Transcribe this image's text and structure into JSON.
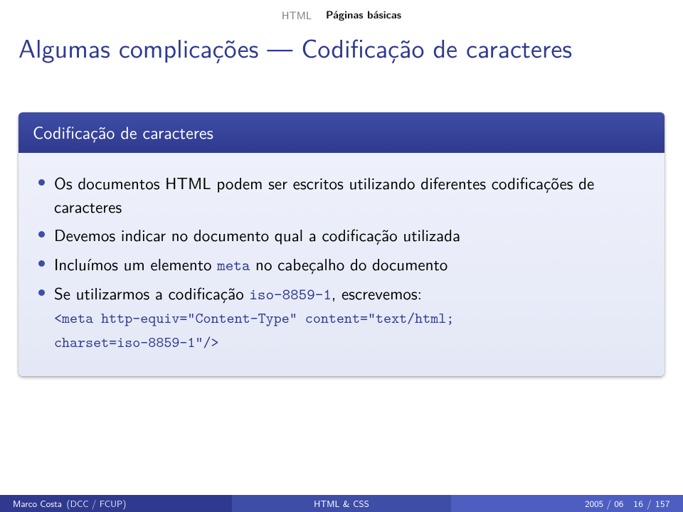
{
  "breadcrumb": {
    "main": "HTML",
    "sub": "Páginas básicas"
  },
  "title": "Algumas complicações — Codificação de caracteres",
  "block": {
    "header": "Codificação de caracteres",
    "items": {
      "i0": "Os documentos HTML podem ser escritos utilizando diferentes codificações de caracteres",
      "i1": "Devemos indicar no documento qual a codificação utilizada",
      "i2a": "Incluímos um elemento ",
      "i2code": "meta",
      "i2b": " no cabeçalho do documento",
      "i3a": "Se utilizarmos a codificação ",
      "i3code1": "iso-8859-1",
      "i3b": ", escrevemos:",
      "i3line1": "<meta http-equiv=\"Content-Type\" content=\"text/html;",
      "i3line2": "charset=iso-8859-1\"/>"
    }
  },
  "footer": {
    "author": "Marco Costa",
    "inst": "(DCC / FCUP)",
    "center": "HTML & CSS",
    "date": "2005 / 06",
    "pages": "16 / 157"
  }
}
